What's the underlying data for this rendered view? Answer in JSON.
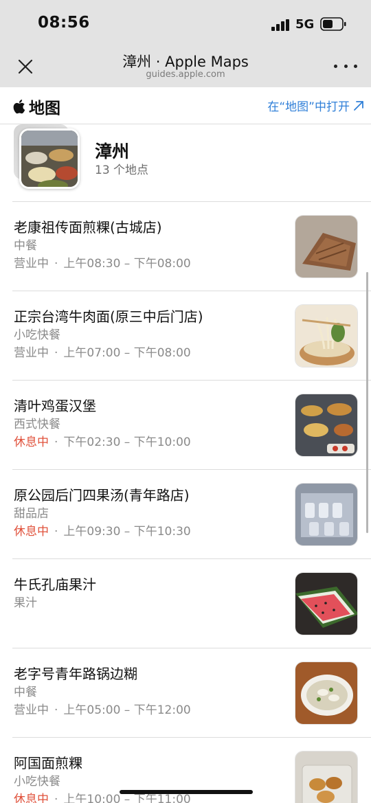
{
  "status_bar": {
    "time": "08:56",
    "network": "5G"
  },
  "browser": {
    "title": "漳州 · Apple Maps",
    "url": "guides.apple.com"
  },
  "maps_header": {
    "brand": "地图",
    "open_link": "在“地图”中打开"
  },
  "guide": {
    "title": "漳州",
    "count": "13 个地点"
  },
  "places": [
    {
      "name": "老康祖传面煎粿(古城店)",
      "category": "中餐",
      "status": "营业中",
      "status_type": "open",
      "hours": "上午08:30 – 下午08:00",
      "image": "food-cake"
    },
    {
      "name": "正宗台湾牛肉面(原三中后门店)",
      "category": "小吃快餐",
      "status": "营业中",
      "status_type": "open",
      "hours": "上午07:00 – 下午08:00",
      "image": "food-noodles"
    },
    {
      "name": "清叶鸡蛋汉堡",
      "category": "西式快餐",
      "status": "休息中",
      "status_type": "closed",
      "hours": "下午02:30 – 下午10:00",
      "image": "food-burger"
    },
    {
      "name": "原公园后门四果汤(青年路店)",
      "category": "甜品店",
      "status": "休息中",
      "status_type": "closed",
      "hours": "上午09:30 – 下午10:30",
      "image": "food-jelly"
    },
    {
      "name": "牛氏孔庙果汁",
      "category": "果汁",
      "status": "",
      "status_type": "none",
      "hours": "",
      "image": "food-watermelon"
    },
    {
      "name": "老字号青年路锅边糊",
      "category": "中餐",
      "status": "营业中",
      "status_type": "open",
      "hours": "上午05:00 – 下午12:00",
      "image": "food-soup"
    },
    {
      "name": "阿国面煎粿",
      "category": "小吃快餐",
      "status": "休息中",
      "status_type": "closed",
      "hours": "上午10:00 – 下午11:00",
      "image": "food-pancake"
    }
  ],
  "colors": {
    "link_blue": "#2f7fd8",
    "closed_red": "#e0503a",
    "muted_gray": "#8a8a8a"
  }
}
